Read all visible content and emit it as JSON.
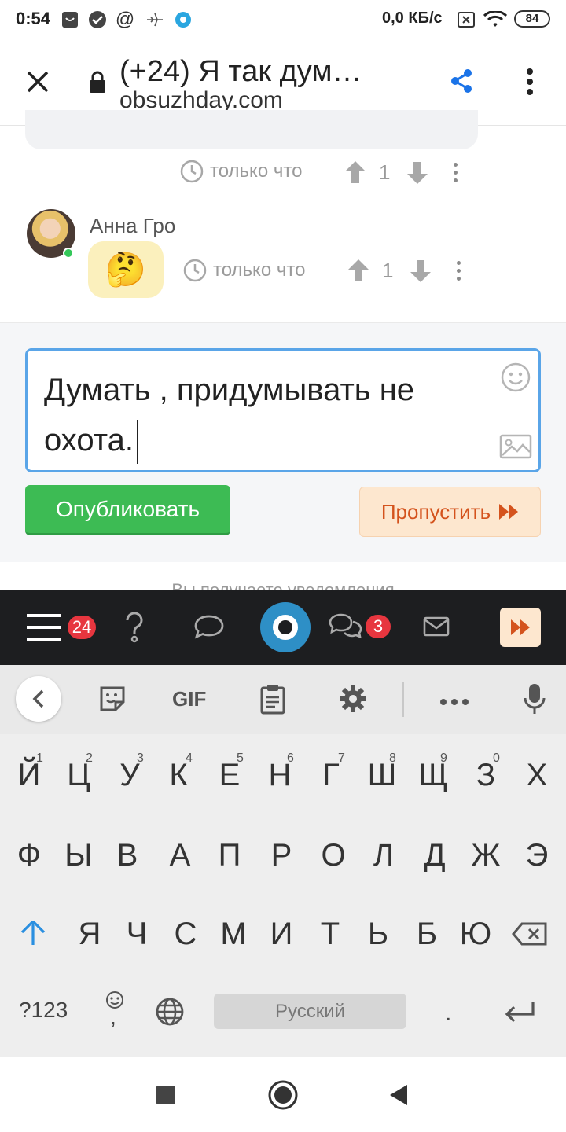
{
  "status_bar": {
    "time": "0:54",
    "network_speed": "0,0 КБ/с",
    "battery": "84"
  },
  "browser": {
    "tab_title": "(+24) Я так дум…",
    "url": "obsuzhday.com"
  },
  "comments": [
    {
      "time": "только что",
      "votes": "1"
    },
    {
      "author": "Анна Гро",
      "emoji": "🤔",
      "time": "только что",
      "votes": "1",
      "online": true
    }
  ],
  "reply": {
    "text_line1": "Думать , придумывать не",
    "text_line2": "охота.",
    "publish_label": "Опубликовать",
    "skip_label": "Пропустить",
    "notify_text": "Вы получаете уведомления"
  },
  "site_nav": {
    "menu_badge": "24",
    "discussions_badge": "3"
  },
  "keyboard": {
    "row1": [
      {
        "k": "Й",
        "n": "1"
      },
      {
        "k": "Ц",
        "n": "2"
      },
      {
        "k": "У",
        "n": "3"
      },
      {
        "k": "К",
        "n": "4"
      },
      {
        "k": "Е",
        "n": "5"
      },
      {
        "k": "Н",
        "n": "6"
      },
      {
        "k": "Г",
        "n": "7"
      },
      {
        "k": "Ш",
        "n": "8"
      },
      {
        "k": "Щ",
        "n": "9"
      },
      {
        "k": "З",
        "n": "0"
      },
      {
        "k": "Х",
        "n": ""
      }
    ],
    "row2": [
      "Ф",
      "Ы",
      "В",
      "А",
      "П",
      "Р",
      "О",
      "Л",
      "Д",
      "Ж",
      "Э"
    ],
    "row3": [
      "Я",
      "Ч",
      "С",
      "М",
      "И",
      "Т",
      "Ь",
      "Б",
      "Ю"
    ],
    "symbols_label": "?123",
    "comma_label": ",",
    "space_label": "Русский",
    "period_label": ".",
    "toolbar_gif": "GIF"
  },
  "colors": {
    "publish": "#3dbb54",
    "skip_text": "#d4531d",
    "skip_bg": "#fde7cf",
    "accent_blue": "#2e8fc6",
    "badge": "#e7363f"
  }
}
